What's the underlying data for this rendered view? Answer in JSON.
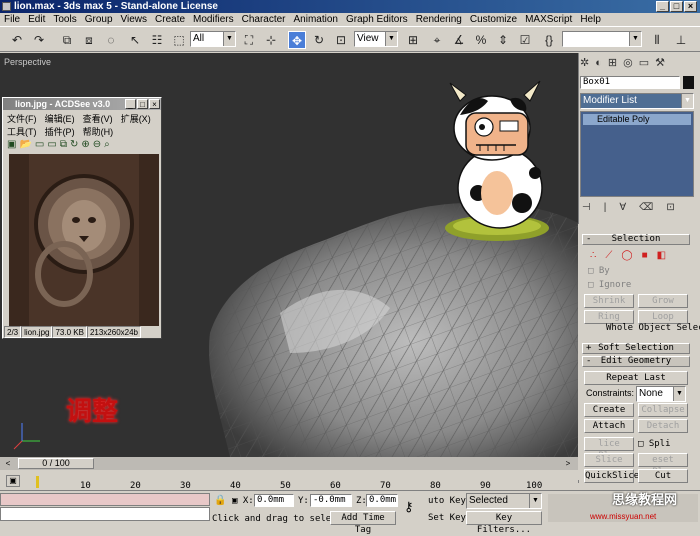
{
  "window": {
    "title": "lion.max - 3ds max 5 - Stand-alone License"
  },
  "menu": [
    "File",
    "Edit",
    "Tools",
    "Group",
    "Views",
    "Create",
    "Modifiers",
    "Character",
    "Animation",
    "Graph Editors",
    "Rendering",
    "Customize",
    "MAXScript",
    "Help"
  ],
  "toolbar": {
    "selection_filter": "All",
    "ref_coord": "View"
  },
  "viewport": {
    "label": "Perspective",
    "overlay_text": "调整"
  },
  "acdsee": {
    "title": "lion.jpg - ACDSee v3.0",
    "menu1": [
      "文件(F)",
      "编辑(E)",
      "查看(V)",
      "扩展(X)"
    ],
    "menu2": [
      "工具(T)",
      "插件(P)",
      "帮助(H)"
    ],
    "status": [
      "2/3",
      "lion.jpg",
      "73.0 KB",
      "213x260x24b"
    ]
  },
  "command_panel": {
    "object_name": "Box01",
    "modifier_list": "Modifier List",
    "stack_item": "Editable Poly",
    "selection_rollout": "Selection",
    "by": "By",
    "ignore": "Ignore",
    "shrink": "Shrink",
    "grow": "Grow",
    "ring": "Ring",
    "loop": "Loop",
    "whole_object": "Whole Object Selected",
    "soft_selection": "Soft Selection",
    "edit_geometry": "Edit Geometry",
    "repeat_last": "Repeat Last",
    "constraints_label": "Constraints:",
    "constraints_value": "None",
    "create": "Create",
    "collapse": "Collapse",
    "attach": "Attach",
    "detach": "Detach",
    "slice_plane": "lice Plan",
    "split": "Spli",
    "slice": "Slice",
    "reset_plane": "eset Plan",
    "quickslice": "QuickSlice",
    "cut": "Cut"
  },
  "timeline": {
    "slider": "0 / 100",
    "ticks": [
      "10",
      "20",
      "30",
      "40",
      "50",
      "60",
      "70",
      "80",
      "90",
      "100"
    ]
  },
  "status": {
    "x_label": "X:",
    "x": "0.0mm",
    "y_label": "Y:",
    "y": "-0.0mm",
    "z_label": "Z:",
    "z": "0.0mm",
    "prompt": "Click and drag to select",
    "add_time_tag": "Add Time Tag",
    "auto_key": "uto Key",
    "set_key": "Set Key",
    "key_mode": "Selected",
    "key_filters": "Key Filters..."
  },
  "watermark": {
    "text": "思缘教程网",
    "url": "www.missyuan.net"
  }
}
